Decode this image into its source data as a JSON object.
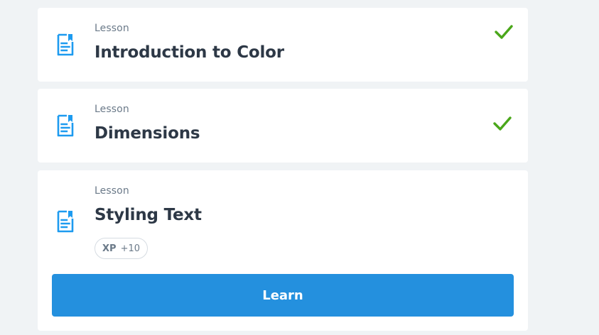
{
  "colors": {
    "background": "#f0f3f5",
    "card": "#ffffff",
    "accent_blue": "#2490de",
    "icon_blue": "#1d9bf0",
    "check_green": "#4aa71a",
    "title_text": "#2d3846",
    "muted_text": "#6b7a89"
  },
  "lessons": [
    {
      "kicker": "Lesson",
      "title": "Introduction to Color",
      "icon": "lesson-document-icon",
      "completed": true,
      "status_icon": "checkmark-icon"
    },
    {
      "kicker": "Lesson",
      "title": "Dimensions",
      "icon": "lesson-document-icon",
      "completed": true,
      "status_icon": "checkmark-icon"
    },
    {
      "kicker": "Lesson",
      "title": "Styling Text",
      "icon": "lesson-document-icon",
      "completed": false,
      "xp_label": "XP",
      "xp_value": "+10",
      "button_label": "Learn"
    }
  ]
}
